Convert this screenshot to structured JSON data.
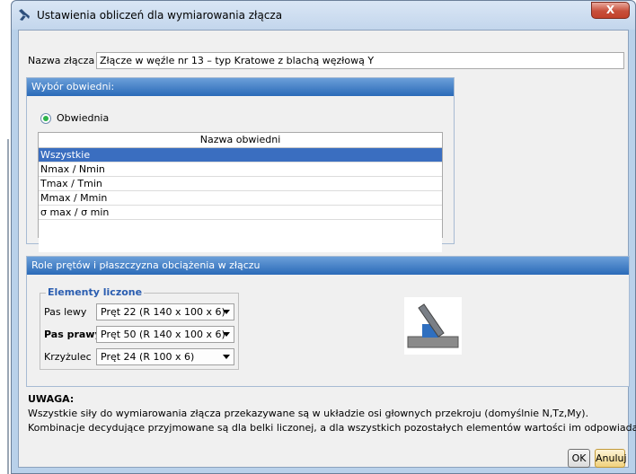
{
  "window": {
    "title": "Ustawienia obliczeń dla wymiarowania złącza",
    "close_label": "X"
  },
  "connection": {
    "name_label": "Nazwa złącza",
    "name_value": "Złącze w węźle nr 13 – typ Kratowe z blachą węzłową Y"
  },
  "envelope_panel": {
    "header": "Wybór obwiedni:",
    "radio_label": "Obwiednia",
    "table_header": "Nazwa obwiedni",
    "rows": [
      "Wszystkie",
      "Nmax / Nmin",
      "Tmax / Tmin",
      "Mmax / Mmin",
      "σ max / σ min"
    ],
    "selected_index": 0
  },
  "roles_panel": {
    "header": "Role prętów i płaszczyzna obciążenia w złączu",
    "group_title": "Elementy liczone",
    "rows": [
      {
        "label": "Pas lewy",
        "value": "Pręt 22 (R 140 x 100 x 6)"
      },
      {
        "label": "Pas prawy",
        "value": "Pręt 50 (R 140 x 100 x 6)"
      },
      {
        "label": "Krzyżulec",
        "value": "Pręt 24 (R 100 x 6)"
      }
    ]
  },
  "note": {
    "title": "UWAGA:",
    "line1": "Wszystkie siły do wymiarowania złącza przekazywane są w układzie osi głownych przekroju (domyślnie N,Tz,My).",
    "line2": "Kombinacje decydujące przyjmowane są dla belki liczonej, a dla wszystkich pozostałych elementów wartości im odpowiadające."
  },
  "buttons": {
    "ok": "OK",
    "cancel": "Anuluj"
  },
  "colors": {
    "header_blue": "#2a6ab8",
    "selection_blue": "#3a6ec0",
    "legend_blue": "#2a5db0",
    "close_red": "#c74f3a"
  }
}
